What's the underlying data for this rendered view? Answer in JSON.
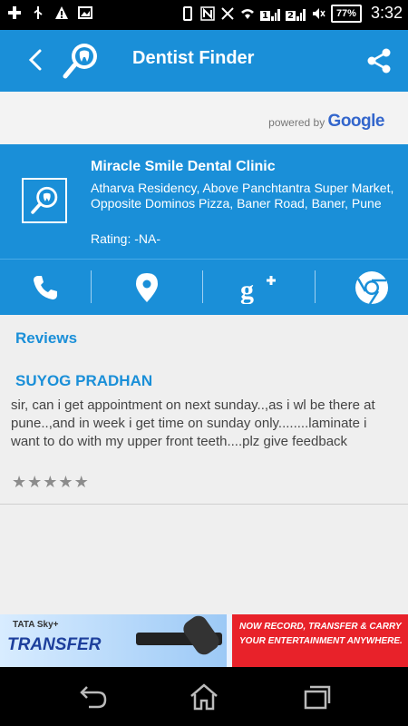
{
  "statusbar": {
    "icons": [
      "add-icon",
      "usb-icon",
      "warning-icon",
      "image-icon",
      "phone-icon",
      "nfc-icon",
      "bluetooth-off-icon",
      "wifi-icon",
      "sim1-signal-icon",
      "sim2-signal-icon",
      "mute-icon",
      "battery-icon"
    ],
    "sim1": "1",
    "sim2": "2",
    "battery": "77%",
    "time": "3:32"
  },
  "appbar": {
    "title": "Dentist Finder"
  },
  "powered": {
    "text": "powered by ",
    "brand": "Google"
  },
  "clinic": {
    "name": "Miracle Smile Dental Clinic",
    "address": "Atharva Residency, Above Panchtantra Super Market, Opposite Dominos Pizza, Baner Road, Baner, Pune",
    "rating": "Rating: -NA-"
  },
  "actions": [
    "call",
    "map",
    "google-plus",
    "chrome"
  ],
  "reviews": {
    "title": "Reviews",
    "items": [
      {
        "author": "SUYOG PRADHAN",
        "text": " sir, can i get appointment on next sunday..,as i wl be there at pune..,and in week i get time on sunday only........laminate i want to do with my upper front teeth....plz give feedback",
        "stars": 0,
        "max_stars": 5
      }
    ]
  },
  "ad": {
    "brand_top": "TATA Sky+",
    "brand": "TRANSFER",
    "line1": "NOW RECORD, TRANSFER & CARRY",
    "line2": "YOUR ENTERTAINMENT ANYWHERE."
  },
  "colors": {
    "primary": "#1a8fd8",
    "ad_red": "#e8222a"
  }
}
